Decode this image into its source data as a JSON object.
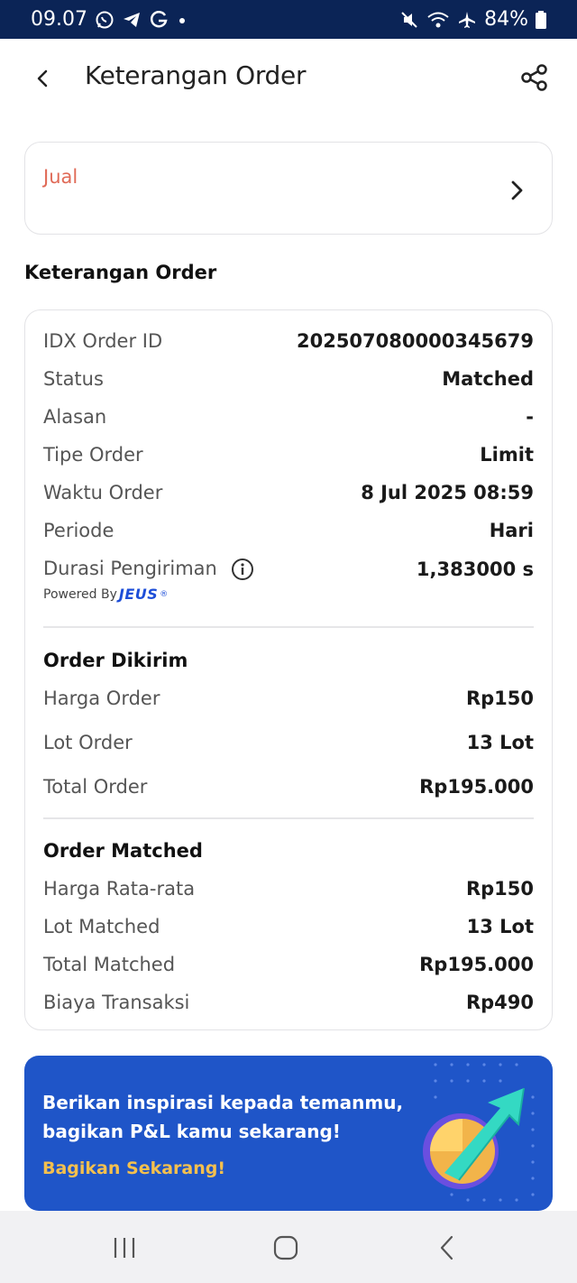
{
  "status_bar": {
    "time": "09.07",
    "left_icons": [
      "whatsapp-icon",
      "telegram-icon",
      "google-icon",
      "dot-icon"
    ],
    "right_icons": [
      "mute-icon",
      "wifi-icon",
      "airplane-icon",
      "battery-icon"
    ],
    "battery": "84%"
  },
  "header": {
    "title": "Keterangan Order",
    "back_icon": "chevron-left-icon",
    "share_icon": "share-icon"
  },
  "order_side": {
    "label": "Jual",
    "color": "#e06a57"
  },
  "section_title": "Keterangan Order",
  "details": [
    {
      "label": "IDX Order ID",
      "value": "202507080000345679"
    },
    {
      "label": "Status",
      "value": "Matched"
    },
    {
      "label": "Alasan",
      "value": "-"
    },
    {
      "label": "Tipe Order",
      "value": "Limit"
    },
    {
      "label": "Waktu Order",
      "value": "8 Jul 2025 08:59"
    },
    {
      "label": "Periode",
      "value": "Hari"
    },
    {
      "label": "Durasi Pengiriman",
      "value": "1,383000 s"
    }
  ],
  "powered_by": {
    "text": "Powered By",
    "logo": "JEUS"
  },
  "order_sent": {
    "title": "Order Dikirim",
    "rows": [
      {
        "label": "Harga Order",
        "value": "Rp150"
      },
      {
        "label": "Lot Order",
        "value": "13 Lot"
      },
      {
        "label": "Total Order",
        "value": "Rp195.000"
      }
    ]
  },
  "order_matched": {
    "title": "Order Matched",
    "rows": [
      {
        "label": "Harga Rata-rata",
        "value": "Rp150"
      },
      {
        "label": "Lot Matched",
        "value": "13 Lot"
      },
      {
        "label": "Total Matched",
        "value": "Rp195.000"
      },
      {
        "label": "Biaya Transaksi",
        "value": "Rp490"
      }
    ]
  },
  "banner": {
    "line1": "Berikan inspirasi kepada temanmu,",
    "line2": "bagikan P&L kamu sekarang!",
    "cta": "Bagikan Sekarang!",
    "bg_color": "#1f55c8",
    "cta_color": "#f4c04e"
  },
  "nav": {
    "icons": [
      "recent-apps-icon",
      "home-icon",
      "back-icon"
    ]
  }
}
